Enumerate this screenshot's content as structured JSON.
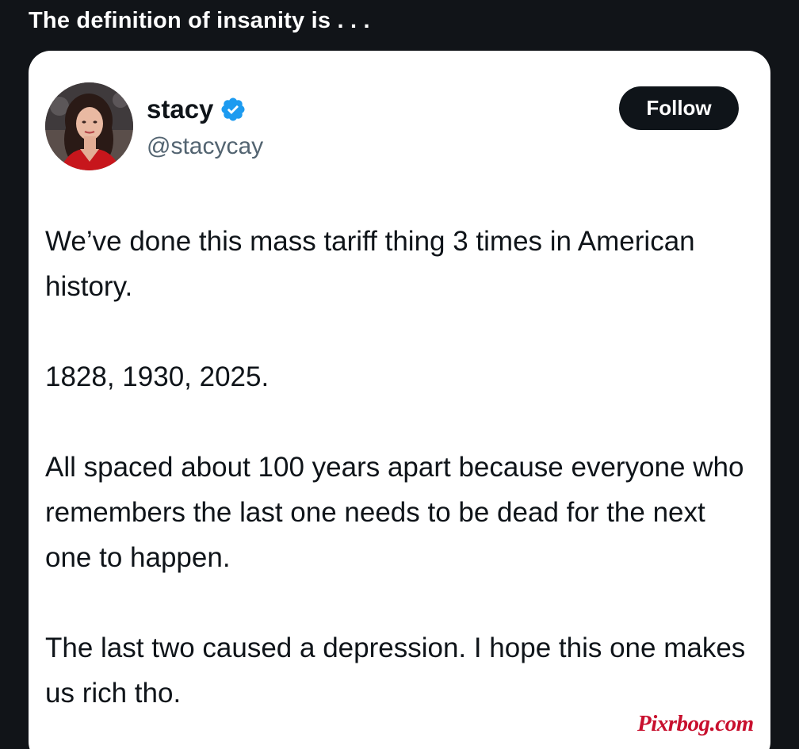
{
  "post": {
    "title": "The definition of insanity is . . ."
  },
  "tweet": {
    "display_name": "stacy",
    "handle": "@stacycay",
    "verified": true,
    "follow_label": "Follow",
    "paragraphs": [
      "We’ve done this mass tariff thing 3 times in American history.",
      "1828, 1930, 2025.",
      "All spaced about 100 years apart because everyone who remembers the last one needs to be dead for the next one to happen.",
      "The last two caused a depression. I hope this one makes us rich tho."
    ]
  },
  "watermark": {
    "text": "Pixrbog.com"
  },
  "icons": {
    "verified": "verified-check-icon"
  },
  "colors": {
    "page_background": "#111418",
    "card_background": "#ffffff",
    "verified_blue": "#1d9bf0",
    "follow_button": "#0f1419",
    "handle_gray": "#536471",
    "watermark_red": "#c8102e"
  }
}
